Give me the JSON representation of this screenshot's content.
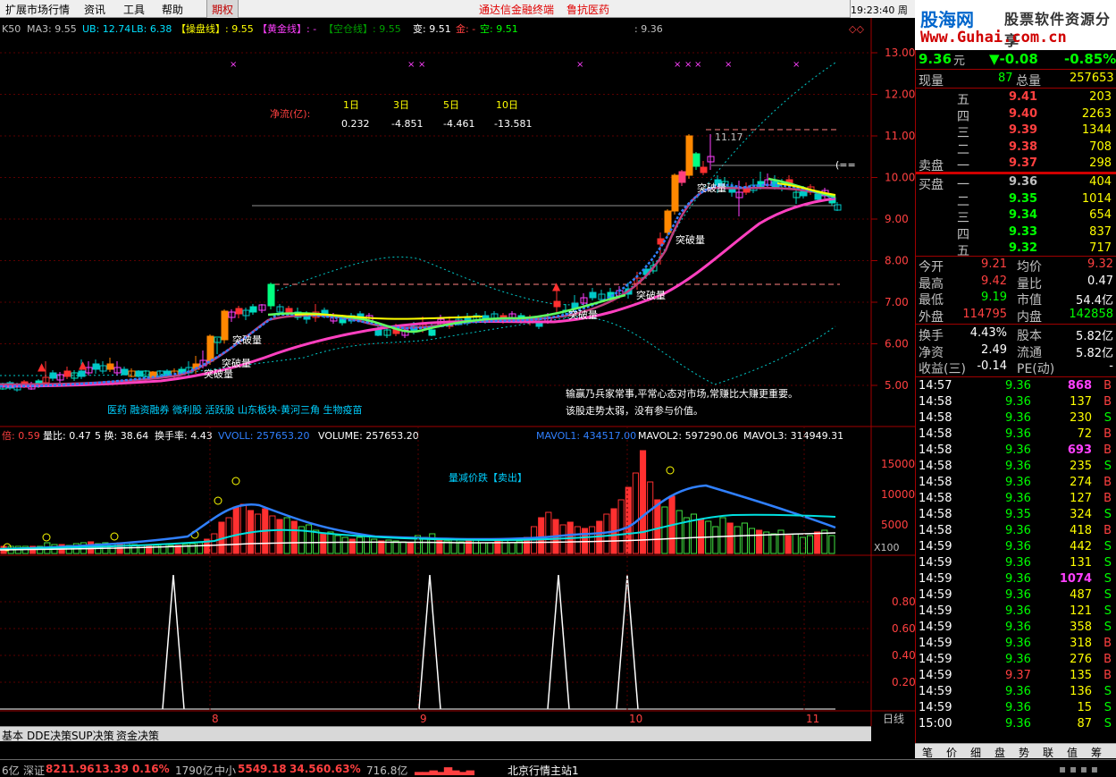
{
  "menu": {
    "items": [
      "扩展市场行情",
      "资讯",
      "工具",
      "帮助"
    ],
    "qi": "期权",
    "promo1": "通达信金融终端",
    "promo2": "鲁抗医药",
    "time": "19:23:40",
    "weekday": "周四"
  },
  "logo": {
    "site": "股海网",
    "slogan": "股票软件资源分享",
    "url": "Www.Guhai.com.cn"
  },
  "indicator": {
    "k": "K50",
    "ma3": "MA3: 9.55",
    "ub": "UB: 12.74",
    "lb": "LB: 6.38",
    "caopan": "【操盘线】: 9.55",
    "huangjin": "【黄金线】: -",
    "kongcang": "【空仓线】: 9.55",
    "bian": "变: 9.51",
    "jin": "金: -",
    "kong": "空: 9.51",
    "val": ": 9.36"
  },
  "netflow": {
    "label": "净流(亿):",
    "headers": [
      "1日",
      "3日",
      "5日",
      "10日"
    ],
    "values": [
      "0.232",
      "-4.851",
      "-4.461",
      "-13.581"
    ]
  },
  "annotations": {
    "tupo": "突破量",
    "high": "11.17",
    "concepts": "医药 融资融券 微利股 活跃股 山东板块-黄河三角 生物疫苗",
    "msg1": "输赢乃兵家常事,平常心态对市场,常赚比大赚更重要。",
    "msg2": "该股走势太弱，没有参与价值。",
    "sell": "量减价跌【卖出】"
  },
  "price_axis": [
    "13.00",
    "12.00",
    "11.00",
    "10.00",
    "9.00",
    "8.00",
    "7.00",
    "6.00",
    "5.00"
  ],
  "volume_header": {
    "bei": "倍: 0.59",
    "liangbi": "量比: 0.47",
    "huan": "5 换: 38.64",
    "hsl": "换手率: 4.43",
    "vvoll": "VVOLL: 257653.20",
    "volume": "VOLUME: 257653.20",
    "mavol1": "MAVOL1: 434517.00",
    "mavol2": "MAVOL2: 597290.06",
    "mavol3": "MAVOL3: 314949.31"
  },
  "volume_axis": [
    "15000",
    "10000",
    "5000"
  ],
  "x100": "X100",
  "ind_axis": [
    "0.80",
    "0.60",
    "0.40",
    "0.20"
  ],
  "x_axis": [
    "8",
    "9",
    "10",
    "11"
  ],
  "rizhi": "日线",
  "bottom_tabs": [
    "基本",
    "DDE决策",
    "SUP决策",
    "资金决策"
  ],
  "quote": {
    "price": "9.36",
    "unit": "元",
    "change": "-0.08",
    "pct": "-0.85%",
    "xianliang_label": "现量",
    "xianliang": "87",
    "zongliang_label": "总量",
    "zongliang": "257653",
    "sell": [
      {
        "n": "五",
        "p": "9.41",
        "v": "203"
      },
      {
        "n": "四",
        "p": "9.40",
        "v": "2263"
      },
      {
        "n": "三",
        "p": "9.39",
        "v": "1344"
      },
      {
        "n": "二",
        "p": "9.38",
        "v": "708"
      },
      {
        "n": "一",
        "p": "9.37",
        "v": "298"
      }
    ],
    "buy": [
      {
        "n": "一",
        "p": "9.36",
        "v": "404"
      },
      {
        "n": "二",
        "p": "9.35",
        "v": "1014"
      },
      {
        "n": "三",
        "p": "9.34",
        "v": "654"
      },
      {
        "n": "四",
        "p": "9.33",
        "v": "837"
      },
      {
        "n": "五",
        "p": "9.32",
        "v": "717"
      }
    ],
    "sell_label": "卖盘",
    "buy_label": "买盘",
    "stats": [
      [
        "今开",
        "9.21",
        "均价",
        "9.32"
      ],
      [
        "最高",
        "9.42",
        "量比",
        "0.47"
      ],
      [
        "最低",
        "9.19",
        "市值",
        "54.4亿"
      ],
      [
        "外盘",
        "114795",
        "内盘",
        "142858"
      ],
      [
        "换手",
        "4.43%",
        "股本",
        "5.82亿"
      ],
      [
        "净资",
        "2.49",
        "流通",
        "5.82亿"
      ],
      [
        "收益(三)",
        "-0.14",
        "PE(动)",
        "-"
      ]
    ],
    "ticks": [
      [
        "14:57",
        "9.36",
        "868",
        "B"
      ],
      [
        "14:58",
        "9.36",
        "137",
        "B"
      ],
      [
        "14:58",
        "9.36",
        "230",
        "S"
      ],
      [
        "14:58",
        "9.36",
        "72",
        "B"
      ],
      [
        "14:58",
        "9.36",
        "693",
        "B"
      ],
      [
        "14:58",
        "9.36",
        "235",
        "S"
      ],
      [
        "14:58",
        "9.36",
        "274",
        "B"
      ],
      [
        "14:58",
        "9.36",
        "127",
        "B"
      ],
      [
        "14:58",
        "9.35",
        "324",
        "S"
      ],
      [
        "14:58",
        "9.36",
        "418",
        "B"
      ],
      [
        "14:59",
        "9.36",
        "442",
        "S"
      ],
      [
        "14:59",
        "9.36",
        "131",
        "S"
      ],
      [
        "14:59",
        "9.36",
        "1074",
        "S"
      ],
      [
        "14:59",
        "9.36",
        "487",
        "S"
      ],
      [
        "14:59",
        "9.36",
        "121",
        "S"
      ],
      [
        "14:59",
        "9.36",
        "358",
        "S"
      ],
      [
        "14:59",
        "9.36",
        "318",
        "B"
      ],
      [
        "14:59",
        "9.36",
        "276",
        "B"
      ],
      [
        "14:59",
        "9.37",
        "135",
        "B"
      ],
      [
        "14:59",
        "9.36",
        "136",
        "S"
      ],
      [
        "14:59",
        "9.36",
        "15",
        "S"
      ],
      [
        "15:00",
        "9.36",
        "87",
        "S"
      ]
    ]
  },
  "right_tabs": [
    "笔",
    "价",
    "细",
    "盘",
    "势",
    "联",
    "值",
    "筹"
  ],
  "status": {
    "a": "6亿",
    "sz": "深证",
    "szv": "8211.96",
    "szc": "13.39",
    "szp": "0.16%",
    "szvol": "1790亿",
    "zx": "中小",
    "zxv": "5549.18",
    "zxc": "34.56",
    "zxp": "0.63%",
    "zxvol": "716.8亿",
    "station": "北京行情主站1"
  }
}
